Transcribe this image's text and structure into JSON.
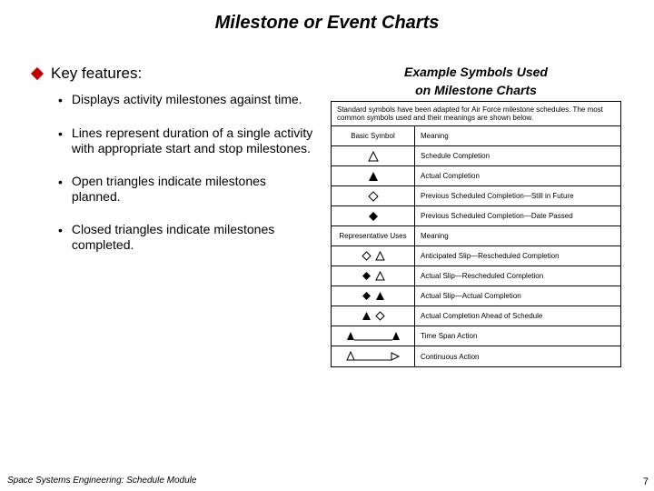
{
  "title": "Milestone or Event Charts",
  "kf_label": "Key features:",
  "bullets": [
    "Displays activity milestones against time.",
    "Lines represent duration of a single activity with appropriate start and stop milestones.",
    "Open triangles indicate milestones planned.",
    "Closed triangles indicate milestones completed."
  ],
  "example_title_1": "Example Symbols Used",
  "example_title_2": "on Milestone Charts",
  "intro": "Standard symbols have been adapted for Air Force milestone schedules. The most common symbols used and their meanings are shown below.",
  "hdr_basic": "Basic Symbol",
  "hdr_meaning": "Meaning",
  "hdr_rep": "Representative Uses",
  "rows_basic": [
    "Schedule Completion",
    "Actual Completion",
    "Previous Scheduled Completion—Still in Future",
    "Previous Scheduled Completion—Date Passed"
  ],
  "rows_rep": [
    "Anticipated Slip—Rescheduled Completion",
    "Actual Slip—Rescheduled Completion",
    "Actual Slip—Actual Completion",
    "Actual Completion Ahead of Schedule",
    "Time Span Action",
    "Continuous Action"
  ],
  "footer_left": "Space Systems Engineering: Schedule Module",
  "footer_right": "7"
}
